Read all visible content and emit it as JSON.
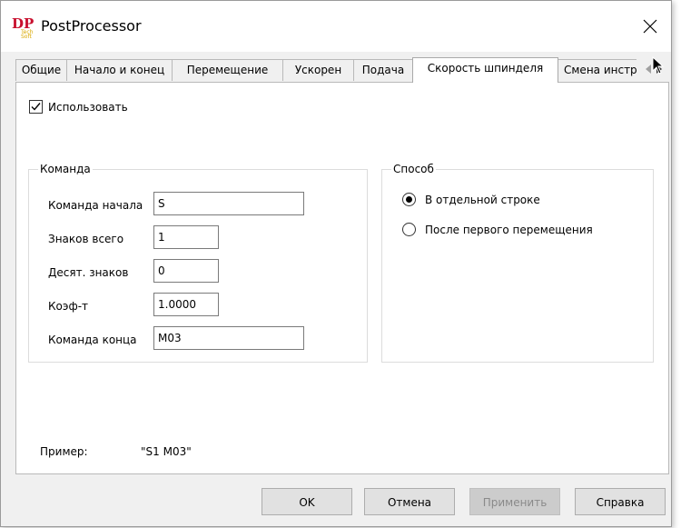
{
  "window": {
    "title": "PostProcessor",
    "icon": "dp-logo-icon"
  },
  "tabs": [
    {
      "label": "Общие",
      "active": false
    },
    {
      "label": "Начало и конец",
      "active": false
    },
    {
      "label": "Перемещение",
      "active": false
    },
    {
      "label": "Ускорен",
      "active": false
    },
    {
      "label": "Подача",
      "active": false
    },
    {
      "label": "Скорость шпинделя",
      "active": true
    },
    {
      "label": "Смена инструмен",
      "active": false
    }
  ],
  "use_checkbox": {
    "label": "Использовать",
    "checked": true
  },
  "command_group": {
    "title": "Команда",
    "fields": [
      {
        "label": "Команда начала",
        "value": "S"
      },
      {
        "label": "Знаков всего",
        "value": "1"
      },
      {
        "label": "Десят. знаков",
        "value": "0"
      },
      {
        "label": "Коэф-т",
        "value": "1.0000"
      },
      {
        "label": "Команда конца",
        "value": "M03"
      }
    ]
  },
  "method_group": {
    "title": "Способ",
    "options": [
      {
        "label": "В отдельной строке",
        "selected": true
      },
      {
        "label": "После первого перемещения",
        "selected": false
      }
    ]
  },
  "example": {
    "label": "Пример:",
    "value": "\"S1 M03\""
  },
  "buttons": {
    "ok": "OK",
    "cancel": "Отмена",
    "apply": "Применить",
    "help": "Справка"
  },
  "colors": {
    "dialog_bg": "#f0f0f0",
    "panel_bg": "#ffffff",
    "logo_red": "#c8102e",
    "logo_gold": "#d9a800"
  }
}
